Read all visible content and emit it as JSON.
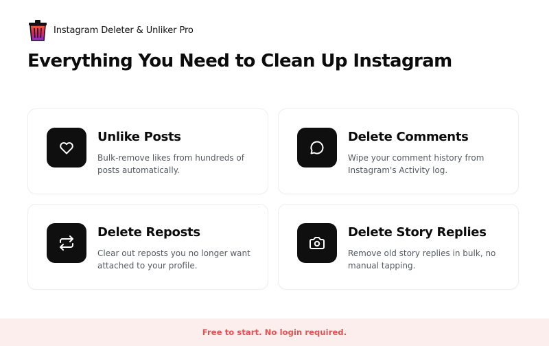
{
  "brand": {
    "name": "Instagram Deleter & Unliker Pro",
    "logo_icon": "trash-bin-icon"
  },
  "headline": "Everything You Need to Clean Up Instagram",
  "features": [
    {
      "title": "Unlike Posts",
      "description": "Bulk-remove likes from hundreds of posts automatically.",
      "icon": "heart-icon"
    },
    {
      "title": "Delete Comments",
      "description": "Wipe your comment history from Instagram's Activity log.",
      "icon": "chat-bubble-icon"
    },
    {
      "title": "Delete Reposts",
      "description": "Clear out reposts you no longer want attached to your profile.",
      "icon": "repost-icon"
    },
    {
      "title": "Delete Story Replies",
      "description": "Remove old story replies in bulk, no manual tapping.",
      "icon": "camera-icon"
    }
  ],
  "footer": {
    "text": "Free to start. No login required."
  },
  "colors": {
    "background": "#ffffff",
    "card_border": "#eeeeee",
    "icon_tile": "#0f0f0f",
    "footer_bg": "#fdeeee",
    "footer_text": "#e45050",
    "logo_gradient_top": "#f15a3c",
    "logo_gradient_bottom": "#8a2be2"
  }
}
